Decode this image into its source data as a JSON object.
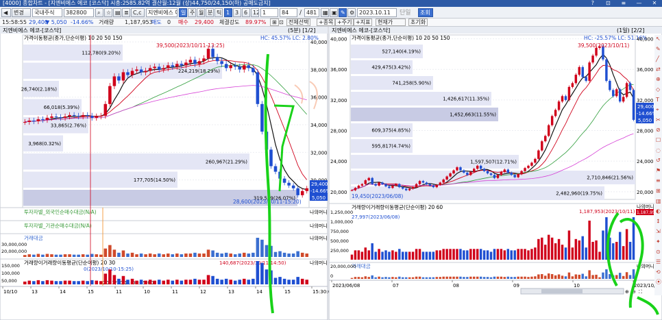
{
  "window": {
    "title": "[4000] 종합차트 - [지엔비에스 에코 [코스닥] 시총:2585.82억 결산월:12월 (상)44,750/24,150(하) 공매도금지]",
    "help_icon": "question-icon",
    "close_icon": "close-icon"
  },
  "toolbar": {
    "nav_prev": "◀",
    "nav_next": "▶",
    "change_label": "변경",
    "market_select": "국내주식",
    "code": "382800",
    "search_icon": "search-icon",
    "star_icon": "star-icon",
    "compare_btn": "C,c",
    "stock_name": "지엔비에스 에...",
    "period_buttons": [
      "일",
      "주",
      "월",
      "분",
      "틱"
    ],
    "period_active": "일",
    "interval_buttons": [
      "1",
      "3",
      "6",
      "12",
      "1"
    ],
    "interval_active": "1",
    "count_value": "84",
    "slash": "/",
    "total_value": "481",
    "date_value": "2023.10.11",
    "single_label": "단일",
    "query_button": "조회"
  },
  "quote": {
    "time": "15:58:55",
    "price": "29,400",
    "change": "▼ 5,050",
    "change_pct": "-14.66%",
    "volume_label": "거래량",
    "volume": "1,187,953",
    "sell_label": "매도",
    "sell_value": "0",
    "buy_label": "매수",
    "buy_value": "29,400",
    "strength_label": "체결강도",
    "strength_value": "89.97%",
    "btn_select_all": "전체선택",
    "btn_indicator": "+종목",
    "btn_main": "+주기",
    "btn_index": "+지표",
    "current_label": "현재가",
    "reset_button": "초기화"
  },
  "left_chart": {
    "header": "지엔비에스 에코-[코스닥]",
    "period_label": "(5분) [1/2]",
    "ma_legend": "가격이동평균(종가,단순이평) 10 20 50 150",
    "hc_lc": "HC: 45.57%  LC: 2.80%",
    "high_annot": "39,500(2023/10/11-13:25)",
    "low_annot": "28,600(2023/10/11-15:20)",
    "price_ticks": [
      "40,000",
      "38,000",
      "36,000",
      "34,000",
      "32,000",
      "30,000"
    ],
    "volume_ticks": [
      "30,000,000",
      "20,000,000",
      "150,000",
      "100,000",
      "50,000"
    ],
    "vol_ma_legend": "거래량이거래량이동평균(단순이평) 20 30",
    "vol_ma_annot": "140,687(2023/10/11-14:50)",
    "vol_zero_annot": "0(2023/10/10-15:25)",
    "vol_low_annot": "2023/10/11-09:25:00",
    "investor_label_1": "투자자별_외국인순매수대금(N/A)",
    "investor_label_2": "투자자별_기관순매수대금(N/A)",
    "amount_label": "거래대금",
    "time_ticks": [
      "10/10",
      "13",
      "14",
      "15",
      "11",
      "10",
      "11",
      "12",
      "13",
      "14",
      "15",
      "15:30:00"
    ],
    "volume_profile": [
      {
        "label": "112,780(9.20%)"
      },
      {
        "label": "224,219(18.29%)"
      },
      {
        "label": "26,740(2.18%)"
      },
      {
        "label": "66,018(5.39%)"
      },
      {
        "label": "33,865(2.76%)"
      },
      {
        "label": "3,968(0.32%)"
      },
      {
        "label": "260,967(21.29%)"
      },
      {
        "label": "177,705(14.50%)"
      },
      {
        "label": "319,559(26.07%)"
      }
    ],
    "last_price_tag": "29,400",
    "last_change_tag": "-14.66%",
    "last_diff_tag": "5,050",
    "mini_right_labels": [
      "나의머니",
      "나의머니",
      "나의머니",
      "나의머니"
    ]
  },
  "right_chart": {
    "header": "지엔비에스 에코-[코스닥]",
    "period_label": "(1일) [2/2]",
    "ma_legend": "가격이동평균(종가,단순이평) 10 20 50 150",
    "hc_lc": "HC: -25.57%  LC: 51.16%",
    "high_annot": "39,500(2023/10/11)",
    "low_annot": "19,450(2023/06/08)",
    "price_ticks": [
      "40,000",
      "36,000",
      "32,000",
      "28,000",
      "24,000",
      "20,000"
    ],
    "volume_ticks": [
      "1,250,000",
      "1,000,000",
      "750,000",
      "500,000",
      "250,000",
      "20,000,000",
      "0"
    ],
    "vol_legend": "거래량이거래량이동평균(단순이평) 20 60",
    "vol_high_annot": "1,187,953(2023/10/11)",
    "vol_low_annot": "27,997(2023/06/08)",
    "amount_label": "거래대금",
    "date_ticks": [
      "2023/06/08",
      "07",
      "08",
      "09",
      "10",
      "2023/10/11"
    ],
    "volume_profile": [
      {
        "label": "527,140(4.19%)"
      },
      {
        "label": "429,475(3.42%)"
      },
      {
        "label": "741,258(5.90%)"
      },
      {
        "label": "1,426,617(11.35%)"
      },
      {
        "label": "1,452,663(11.55%)"
      },
      {
        "label": "609,375(4.85%)"
      },
      {
        "label": "595,817(4.74%)"
      },
      {
        "label": "1,597,507(12.71%)"
      },
      {
        "label": "2,710,846(21.56%)"
      },
      {
        "label": "2,482,960(19.75%)"
      }
    ],
    "last_price_tag": "29,400",
    "last_change_tag": "-14.66%",
    "last_diff_tag": "5,050",
    "vol_tag": "1,187,953",
    "mini_right_labels": [
      "나의머니",
      "나의머니"
    ]
  },
  "chart_data": [
    {
      "type": "candlestick",
      "title": "지엔비에스 에코-[코스닥] (5분)",
      "ylim": [
        28000,
        40500
      ],
      "high": {
        "value": 39500,
        "time": "2023/10/11-13:25"
      },
      "low": {
        "value": 28600,
        "time": "2023/10/11-15:20"
      },
      "series": [
        {
          "name": "close_5min",
          "values": [
            34200,
            34300,
            34250,
            34400,
            34350,
            34500,
            34600,
            34550,
            34500,
            34600,
            34700,
            34650,
            34600,
            34700,
            34650,
            34500,
            34600,
            34650,
            35500,
            36800,
            37500,
            37200,
            37800,
            37600,
            37900,
            38000,
            37800,
            37900,
            38100,
            38200,
            38000,
            38100,
            38300,
            38200,
            38400,
            38300,
            38500,
            38700,
            38400,
            38600,
            38800,
            39500,
            38900,
            38600,
            38400,
            38100,
            38300,
            38200,
            38000,
            38300,
            38100,
            37800,
            35500,
            33500,
            32200,
            31000,
            30600,
            30100,
            29800,
            29600,
            29400,
            28900,
            29200,
            29400
          ]
        }
      ]
    },
    {
      "type": "candlestick",
      "title": "지엔비에스 에코-[코스닥] (1일)",
      "ylim": [
        19000,
        40500
      ],
      "high": {
        "value": 39500,
        "time": "2023/10/11"
      },
      "low": {
        "value": 19450,
        "time": "2023/06/08"
      },
      "series": [
        {
          "name": "close_daily",
          "values": [
            20200,
            20500,
            20800,
            21000,
            21500,
            21800,
            21000,
            20800,
            21200,
            21000,
            20700,
            20500,
            20800,
            21000,
            20600,
            20400,
            20200,
            20400,
            20600,
            21000,
            21400,
            21200,
            21000,
            20800,
            20600,
            20900,
            21200,
            21600,
            22000,
            22400,
            22800,
            23200,
            22800,
            22500,
            22200,
            22600,
            23000,
            23400,
            23000,
            22700,
            22400,
            22200,
            21800,
            22200,
            22600,
            22900,
            22500,
            22200,
            21900,
            22300,
            22700,
            23100,
            23400,
            23800,
            24300,
            25400,
            26600,
            27300,
            28700,
            29900,
            30700,
            31800,
            32500,
            32000,
            33700,
            34200,
            35300,
            36300,
            35000,
            34500,
            36900,
            37800,
            38800,
            39000,
            37300,
            34500,
            33300,
            32500,
            33400,
            31800,
            32400,
            34200,
            33300,
            29400
          ]
        }
      ]
    }
  ]
}
